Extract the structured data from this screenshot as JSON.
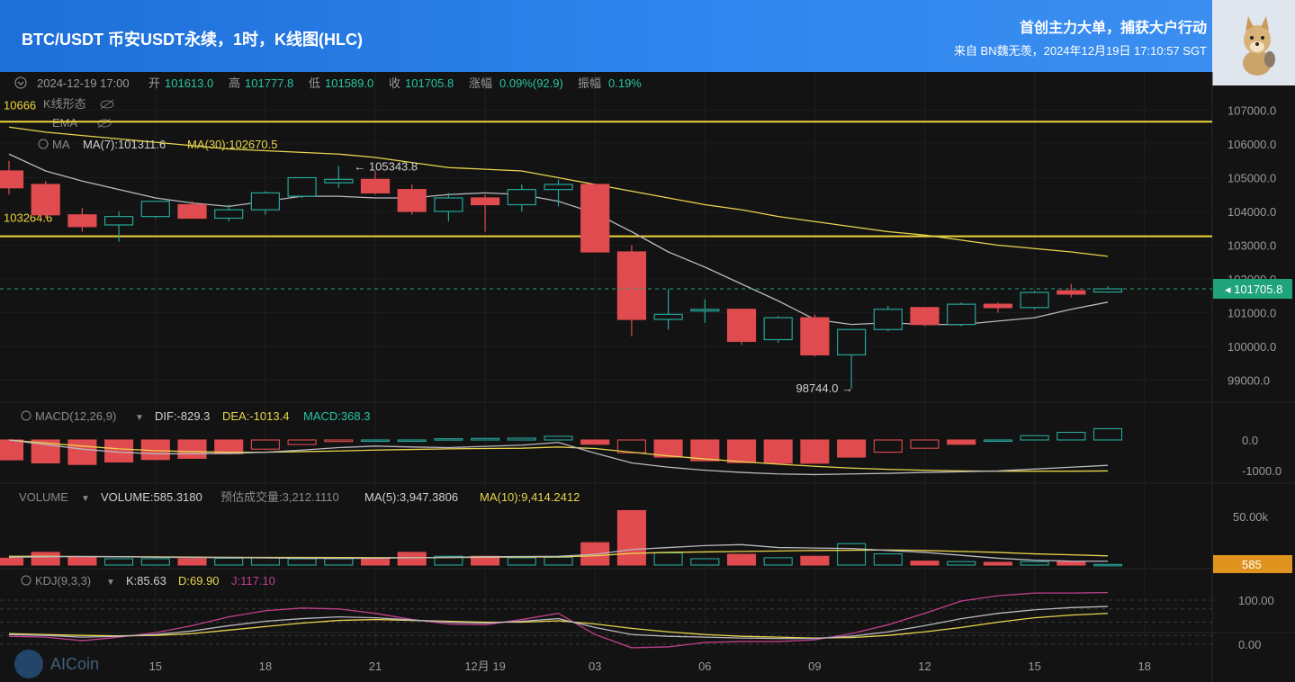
{
  "header": {
    "title": "BTC/USDT 币安USDT永续，1时，K线图(HLC)",
    "tagline": "首创主力大单，捕获大户行动",
    "source": "来自 BN魏无羡，2024年12月19日 17:10:57 SGT"
  },
  "ohlc_bar": {
    "datetime": "2024-12-19 17:00",
    "open_label": "开",
    "open": "101613.0",
    "high_label": "高",
    "high": "101777.8",
    "low_label": "低",
    "low": "101589.0",
    "close_label": "收",
    "close": "101705.8",
    "change_label": "涨幅",
    "change": "0.09%(92.9)",
    "amp_label": "振幅",
    "amp": "0.19%"
  },
  "overlays": {
    "pattern": "K线形态",
    "ema": "EMA",
    "ma": "MA",
    "ma7": "MA(7):101311.6",
    "ma30": "MA(30):102670.5"
  },
  "macd": {
    "label": "MACD(12,26,9)",
    "dif": "DIF:-829.3",
    "dea": "DEA:-1013.4",
    "macd": "MACD:368.3"
  },
  "volume": {
    "label": "VOLUME",
    "vol": "VOLUME:585.3180",
    "est": "预估成交量:3,212.1110",
    "ma5": "MA(5):3,947.3806",
    "ma10": "MA(10):9,414.2412"
  },
  "kdj": {
    "label": "KDJ(9,3,3)",
    "k": "K:85.63",
    "d": "D:69.90",
    "j": "J:117.10"
  },
  "watermark": "AICoin",
  "colors": {
    "up": "#26a69a",
    "down": "#e04b4f",
    "ma7": "#b8b8c0",
    "ma30": "#e8d44d",
    "hline": "#f0d43a",
    "j": "#c2408f",
    "price_tag": "#1fa37a",
    "vol_tag": "#e0941f"
  },
  "chart_data": [
    {
      "type": "candlestick",
      "title": "BTC/USDT 1H",
      "y_ticks": [
        99000,
        100000,
        101000,
        102000,
        103000,
        104000,
        105000,
        106000,
        107000
      ],
      "y_tick_labels": [
        "99000.0",
        "100000.0",
        "101000.0",
        "102000.0",
        "103000.0",
        "104000.0",
        "105000.0",
        "106000.0",
        "107000.0"
      ],
      "x_ticks": [
        {
          "i": 4,
          "label": "15"
        },
        {
          "i": 7,
          "label": "18"
        },
        {
          "i": 10,
          "label": "21"
        },
        {
          "i": 13,
          "label": "12月 19"
        },
        {
          "i": 16,
          "label": "03"
        },
        {
          "i": 19,
          "label": "06"
        },
        {
          "i": 22,
          "label": "09"
        },
        {
          "i": 25,
          "label": "12"
        },
        {
          "i": 28,
          "label": "15"
        },
        {
          "i": 31,
          "label": "18"
        }
      ],
      "candles": [
        [
          105200,
          105500,
          104500,
          104700
        ],
        [
          104800,
          104900,
          103800,
          103900
        ],
        [
          103900,
          104100,
          103400,
          103550
        ],
        [
          103600,
          104000,
          103100,
          103850
        ],
        [
          103850,
          104300,
          103800,
          104300
        ],
        [
          104200,
          104300,
          103800,
          103800
        ],
        [
          103800,
          104200,
          103700,
          104050
        ],
        [
          104050,
          104600,
          103900,
          104550
        ],
        [
          104450,
          105000,
          104400,
          105000
        ],
        [
          104850,
          105343.8,
          104700,
          104950
        ],
        [
          104950,
          105200,
          104500,
          104550
        ],
        [
          104650,
          104800,
          103900,
          104000
        ],
        [
          104000,
          104550,
          103700,
          104400
        ],
        [
          104400,
          104500,
          103400,
          104200
        ],
        [
          104200,
          104800,
          104000,
          104650
        ],
        [
          104650,
          104950,
          104150,
          104800
        ],
        [
          104800,
          104800,
          102800,
          102800
        ],
        [
          102800,
          103000,
          100300,
          100800
        ],
        [
          100800,
          101700,
          100500,
          100950
        ],
        [
          101050,
          101400,
          100700,
          101100
        ],
        [
          101100,
          101100,
          100050,
          100150
        ],
        [
          100200,
          100900,
          100100,
          100850
        ],
        [
          100850,
          100950,
          99700,
          99750
        ],
        [
          99750,
          100500,
          98744,
          100500
        ],
        [
          100500,
          101200,
          100450,
          101100
        ],
        [
          101150,
          101150,
          100600,
          100650
        ],
        [
          100650,
          101300,
          100600,
          101250
        ],
        [
          101250,
          101300,
          101000,
          101150
        ],
        [
          101150,
          101650,
          101100,
          101600
        ],
        [
          101650,
          101850,
          101450,
          101550
        ],
        [
          101613,
          101777.8,
          101589,
          101705.8
        ]
      ],
      "ma7": [
        105700,
        105200,
        104900,
        104650,
        104400,
        104250,
        104150,
        104300,
        104450,
        104450,
        104400,
        104400,
        104500,
        104550,
        104500,
        104300,
        103950,
        103400,
        102800,
        102350,
        101850,
        101350,
        100800,
        100650,
        100700,
        100650,
        100650,
        100750,
        100850,
        101100,
        101311.6
      ],
      "ma30": [
        106500,
        106350,
        106250,
        106150,
        106050,
        105950,
        105850,
        105800,
        105750,
        105700,
        105600,
        105450,
        105300,
        105250,
        105200,
        105000,
        104800,
        104600,
        104400,
        104200,
        104050,
        103850,
        103700,
        103550,
        103400,
        103300,
        103150,
        103000,
        102900,
        102800,
        102670.5
      ],
      "hlines": [
        {
          "value": 106660,
          "label": "10666"
        },
        {
          "value": 103264.6,
          "label": "103264.6"
        }
      ],
      "annotations": {
        "high": "← 105343.8",
        "low": "98744.0 →"
      },
      "last_price_label": "101705.8"
    },
    {
      "type": "bar",
      "title": "MACD(12,26,9)",
      "y_ticks": [
        0,
        -1000
      ],
      "y_tick_labels": [
        "0.0",
        "-1000.0"
      ],
      "hist": [
        -650,
        -750,
        -800,
        -720,
        -640,
        -600,
        -450,
        -300,
        -150,
        -50,
        0,
        0,
        40,
        50,
        60,
        120,
        -140,
        -420,
        -560,
        -680,
        -740,
        -760,
        -760,
        -560,
        -400,
        -270,
        -140,
        0,
        140,
        250,
        368.3
      ],
      "dif": [
        0,
        -150,
        -300,
        -400,
        -450,
        -450,
        -440,
        -400,
        -330,
        -250,
        -200,
        -230,
        -250,
        -210,
        -170,
        -80,
        -430,
        -750,
        -890,
        -990,
        -1060,
        -1110,
        -1130,
        -1110,
        -1090,
        -1060,
        -1040,
        -1010,
        -950,
        -890,
        -829.3
      ],
      "dea": [
        0,
        -100,
        -200,
        -290,
        -350,
        -380,
        -400,
        -400,
        -380,
        -360,
        -330,
        -310,
        -290,
        -280,
        -270,
        -230,
        -280,
        -400,
        -520,
        -620,
        -710,
        -790,
        -860,
        -920,
        -960,
        -990,
        -1010,
        -1020,
        -1020,
        -1020,
        -1013.4
      ]
    },
    {
      "type": "bar",
      "title": "VOLUME",
      "y_ticks": [
        50000
      ],
      "y_tick_labels": [
        "50.00k"
      ],
      "volume": [
        7000,
        13000,
        8500,
        6500,
        6500,
        6500,
        7000,
        7500,
        6500,
        6500,
        6500,
        13000,
        9000,
        9000,
        7500,
        8000,
        23000,
        56000,
        12500,
        6500,
        11000,
        7500,
        9000,
        22000,
        11500,
        4000,
        3500,
        2800,
        3500,
        3200,
        585
      ],
      "vol_ma5": [
        8000,
        8500,
        8800,
        8600,
        8000,
        7800,
        7600,
        7300,
        7000,
        6800,
        7000,
        7500,
        8000,
        8500,
        8800,
        9000,
        11000,
        16000,
        18000,
        20000,
        21000,
        18000,
        17500,
        17000,
        15000,
        13000,
        10000,
        7000,
        5000,
        4000,
        3947.38
      ],
      "vol_ma10": [
        9000,
        9000,
        8800,
        8600,
        8400,
        8200,
        8000,
        7800,
        7800,
        7700,
        7600,
        7600,
        7700,
        8000,
        8200,
        8400,
        9500,
        12000,
        13000,
        13500,
        14000,
        14500,
        15000,
        15200,
        15500,
        15000,
        14000,
        13000,
        11500,
        10500,
        9414.24
      ],
      "last_label": "585"
    },
    {
      "type": "line",
      "title": "KDJ(9,3,3)",
      "y_ticks": [
        0,
        100
      ],
      "y_tick_labels": [
        "0.00",
        "100.00"
      ],
      "k": [
        22,
        20,
        16,
        18,
        22,
        30,
        42,
        52,
        58,
        62,
        60,
        55,
        50,
        48,
        52,
        58,
        38,
        22,
        18,
        16,
        14,
        13,
        13,
        18,
        28,
        42,
        58,
        70,
        78,
        83,
        85.63
      ],
      "d": [
        24,
        22,
        20,
        19,
        20,
        24,
        32,
        40,
        48,
        54,
        56,
        54,
        52,
        50,
        50,
        53,
        46,
        36,
        28,
        22,
        18,
        16,
        14,
        15,
        20,
        28,
        38,
        50,
        60,
        66,
        69.9
      ],
      "j": [
        18,
        16,
        8,
        16,
        26,
        42,
        62,
        76,
        82,
        80,
        70,
        56,
        46,
        44,
        56,
        70,
        22,
        -8,
        -6,
        4,
        6,
        6,
        10,
        24,
        44,
        70,
        98,
        110,
        116,
        116,
        117.1
      ]
    }
  ]
}
